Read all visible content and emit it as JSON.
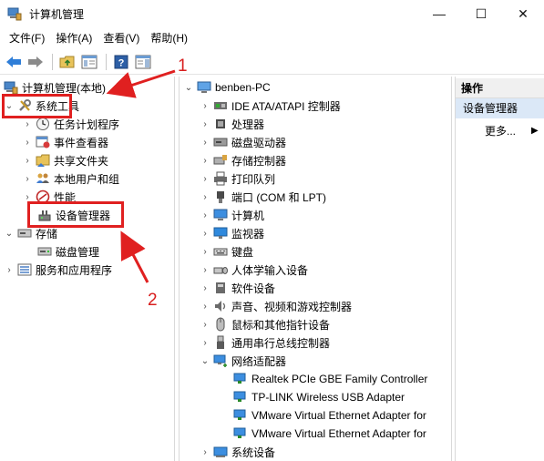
{
  "window": {
    "title": "计算机管理",
    "minimize": "—",
    "maximize": "☐",
    "close": "✕"
  },
  "menu": [
    "文件(F)",
    "操作(A)",
    "查看(V)",
    "帮助(H)"
  ],
  "left_tree": {
    "root": "计算机管理(本地)",
    "system_tools": "系统工具",
    "task_scheduler": "任务计划程序",
    "event_viewer": "事件查看器",
    "shared_folders": "共享文件夹",
    "local_users": "本地用户和组",
    "performance": "性能",
    "device_manager": "设备管理器",
    "storage": "存储",
    "disk_management": "磁盘管理",
    "services_apps": "服务和应用程序"
  },
  "device_tree": {
    "computer": "benben-PC",
    "categories": [
      "IDE ATA/ATAPI 控制器",
      "处理器",
      "磁盘驱动器",
      "存储控制器",
      "打印队列",
      "端口 (COM 和 LPT)",
      "计算机",
      "监视器",
      "键盘",
      "人体学输入设备",
      "软件设备",
      "声音、视频和游戏控制器",
      "鼠标和其他指针设备",
      "通用串行总线控制器",
      "网络适配器"
    ],
    "network_adapters": [
      "Realtek PCIe GBE Family Controller",
      "TP-LINK Wireless USB Adapter",
      "VMware Virtual Ethernet Adapter for",
      "VMware Virtual Ethernet Adapter for"
    ],
    "system_devices": "系统设备"
  },
  "actions": {
    "header": "操作",
    "device_manager": "设备管理器",
    "more": "更多...",
    "more_arrow": "▶"
  },
  "annotations": {
    "step1": "1",
    "step2": "2"
  },
  "colors": {
    "annotation_red": "#e02020",
    "action_highlight": "#dbe8f7"
  }
}
